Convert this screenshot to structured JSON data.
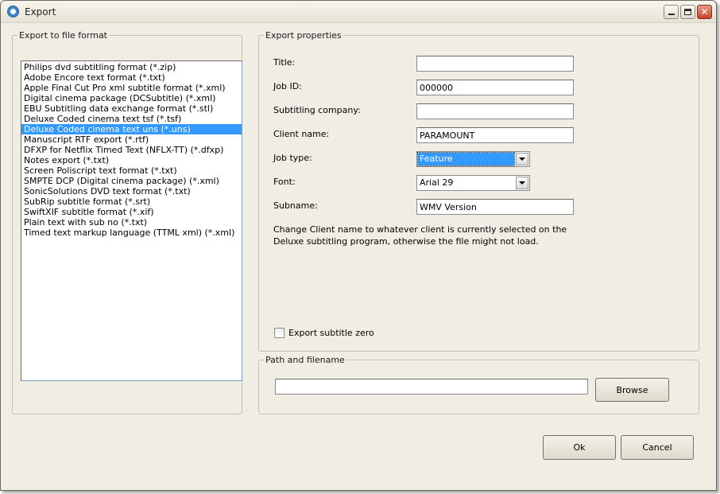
{
  "window": {
    "title": "Export",
    "controls": {
      "minimize": "minimize-icon",
      "maximize": "maximize-icon",
      "close": "close-icon"
    }
  },
  "format_group": {
    "legend": "Export to file format",
    "selected_index": 6,
    "selection_color": "#3399ff",
    "items": [
      "Philips dvd subtitling format (*.zip)",
      "Adobe Encore text format (*.txt)",
      "Apple Final Cut Pro xml subtitle format (*.xml)",
      "Digital cinema package (DCSubtitle) (*.xml)",
      "EBU Subtitling data exchange format (*.stl)",
      "Deluxe Coded cinema text tsf (*.tsf)",
      "Deluxe Coded cinema text uns (*.uns)",
      "Manuscript RTF export (*.rtf)",
      "DFXP for Netflix Timed Text (NFLX-TT) (*.dfxp)",
      "Notes export (*.txt)",
      "Screen Poliscript text format (*.txt)",
      "SMPTE DCP (Digital cinema package) (*.xml)",
      "SonicSolutions DVD text format (*.txt)",
      "SubRip subtitle format (*.srt)",
      "SwiftXIF subtitle format (*.xif)",
      "Plain text with sub no (*.txt)",
      "Timed text markup language (TTML xml) (*.xml)"
    ]
  },
  "properties": {
    "legend": "Export properties",
    "title": {
      "label": "Title:",
      "value": ""
    },
    "job_id": {
      "label": "Job ID:",
      "value": "000000"
    },
    "company": {
      "label": "Subtitling company:",
      "value": ""
    },
    "client": {
      "label": "Client name:",
      "value": "PARAMOUNT"
    },
    "job_type": {
      "label": "Job type:",
      "value": "Feature"
    },
    "font": {
      "label": "Font:",
      "value": "Arial 29"
    },
    "subname": {
      "label": "Subname:",
      "value": "WMV Version"
    },
    "note": "Change Client name to whatever client is currently selected on the Deluxe subtitling program, otherwise the file might not load.",
    "export_zero": {
      "label": "Export subtitle zero",
      "checked": false
    }
  },
  "path_group": {
    "legend": "Path and filename",
    "value": "",
    "browse_label": "Browse"
  },
  "buttons": {
    "ok": "Ok",
    "cancel": "Cancel"
  }
}
